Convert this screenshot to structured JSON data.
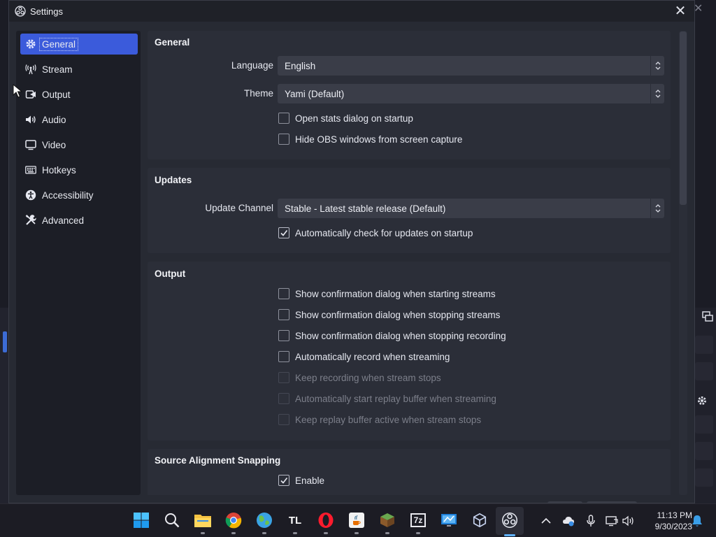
{
  "window": {
    "title": "Settings",
    "close_glyph": "✕"
  },
  "sidebar": {
    "items": [
      {
        "label": "General",
        "icon": "gear-icon"
      },
      {
        "label": "Stream",
        "icon": "antenna-icon"
      },
      {
        "label": "Output",
        "icon": "output-icon"
      },
      {
        "label": "Audio",
        "icon": "speaker-icon"
      },
      {
        "label": "Video",
        "icon": "monitor-icon"
      },
      {
        "label": "Hotkeys",
        "icon": "keyboard-icon"
      },
      {
        "label": "Accessibility",
        "icon": "accessibility-icon"
      },
      {
        "label": "Advanced",
        "icon": "tools-icon"
      }
    ],
    "active_index": 0
  },
  "general": {
    "title": "General",
    "language_label": "Language",
    "language_value": "English",
    "theme_label": "Theme",
    "theme_value": "Yami (Default)",
    "checks": [
      {
        "label": "Open stats dialog on startup",
        "checked": false
      },
      {
        "label": "Hide OBS windows from screen capture",
        "checked": false
      }
    ]
  },
  "updates": {
    "title": "Updates",
    "channel_label": "Update Channel",
    "channel_value": "Stable - Latest stable release (Default)",
    "checks": [
      {
        "label": "Automatically check for updates on startup",
        "checked": true
      }
    ]
  },
  "output": {
    "title": "Output",
    "checks": [
      {
        "label": "Show confirmation dialog when starting streams",
        "checked": false,
        "disabled": false
      },
      {
        "label": "Show confirmation dialog when stopping streams",
        "checked": false,
        "disabled": false
      },
      {
        "label": "Show confirmation dialog when stopping recording",
        "checked": false,
        "disabled": false
      },
      {
        "label": "Automatically record when streaming",
        "checked": false,
        "disabled": false
      },
      {
        "label": "Keep recording when stream stops",
        "checked": false,
        "disabled": true
      },
      {
        "label": "Automatically start replay buffer when streaming",
        "checked": false,
        "disabled": true
      },
      {
        "label": "Keep replay buffer active when stream stops",
        "checked": false,
        "disabled": true
      }
    ]
  },
  "snapping": {
    "title": "Source Alignment Snapping",
    "checks": [
      {
        "label": "Enable",
        "checked": true
      }
    ]
  },
  "taskbar": {
    "apps": [
      "start-icon",
      "search-icon",
      "file-explorer-icon",
      "chrome-icon",
      "maps-icon",
      "tl-icon",
      "opera-icon",
      "java-icon",
      "minecraft-icon",
      "7zip-icon",
      "remote-desktop-icon",
      "virtualbox-icon",
      "obs-icon"
    ],
    "tl_label": "TL",
    "sevenzip_label": "7z",
    "time": "11:13 PM",
    "date": "9/30/2023"
  },
  "colors": {
    "accent": "#3b5bdb",
    "dialog_bg": "#272a33",
    "section_bg": "#2b2e38",
    "taskbar_bg": "#1c1c24"
  }
}
